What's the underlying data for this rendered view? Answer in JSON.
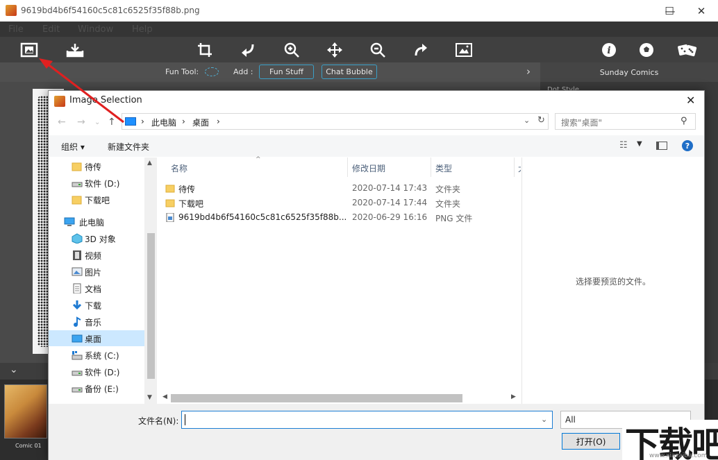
{
  "window": {
    "title": "9619bd4b6f54160c5c81c6525f35f88b.png",
    "controls": [
      "—",
      "☐",
      "✕"
    ]
  },
  "menu": [
    "File",
    "Edit",
    "Window",
    "Help"
  ],
  "funbar": {
    "fun_tool": "Fun Tool:",
    "add": "Add :",
    "fun_stuff": "Fun Stuff",
    "chat_bubble": "Chat Bubble",
    "panel_title": "Sunday Comics"
  },
  "right_panel": {
    "dot_style": "Dot Style"
  },
  "thumbnail": {
    "label": "Comic 01"
  },
  "dialog": {
    "title": "Image Selection",
    "address": {
      "crumb1": "此电脑",
      "crumb2": "桌面",
      "sep": "›"
    },
    "search_placeholder": "搜索\"桌面\"",
    "commands": {
      "organize": "组织 ▾",
      "new_folder": "新建文件夹"
    },
    "nav_items": [
      {
        "label": "待传",
        "icon": "folder-icon"
      },
      {
        "label": "软件 (D:)",
        "icon": "drive-icon"
      },
      {
        "label": "下载吧",
        "icon": "folder-icon"
      },
      {
        "label": "此电脑",
        "icon": "pc-icon"
      },
      {
        "label": "3D 对象",
        "icon": "cube-icon"
      },
      {
        "label": "视频",
        "icon": "video-icon"
      },
      {
        "label": "图片",
        "icon": "pictures-icon"
      },
      {
        "label": "文档",
        "icon": "document-icon"
      },
      {
        "label": "下载",
        "icon": "download-icon"
      },
      {
        "label": "音乐",
        "icon": "music-icon"
      },
      {
        "label": "桌面",
        "icon": "desktop-icon"
      },
      {
        "label": "系统 (C:)",
        "icon": "system-drive-icon"
      },
      {
        "label": "软件 (D:)",
        "icon": "drive-icon"
      },
      {
        "label": "备份 (E:)",
        "icon": "drive-icon"
      }
    ],
    "columns": {
      "name": "名称",
      "date": "修改日期",
      "type": "类型",
      "size": "大"
    },
    "files": [
      {
        "name": "待传",
        "date": "2020-07-14 17:43",
        "type": "文件夹"
      },
      {
        "name": "下载吧",
        "date": "2020-07-14 17:44",
        "type": "文件夹"
      },
      {
        "name": "9619bd4b6f54160c5c81c6525f35f88b...",
        "date": "2020-06-29 16:16",
        "type": "PNG 文件"
      }
    ],
    "preview_text": "选择要预览的文件。",
    "filename_label": "文件名(N):",
    "filename_value": "",
    "filetype": "All",
    "open_button": "打开(O)"
  },
  "watermark": {
    "main": "下载吧",
    "sub": "www.xiazaiba.com"
  },
  "colors": {
    "accent": "#3aa0c8",
    "selection": "#cce8ff",
    "arrow": "#e02020",
    "app_dark": "#404040"
  }
}
